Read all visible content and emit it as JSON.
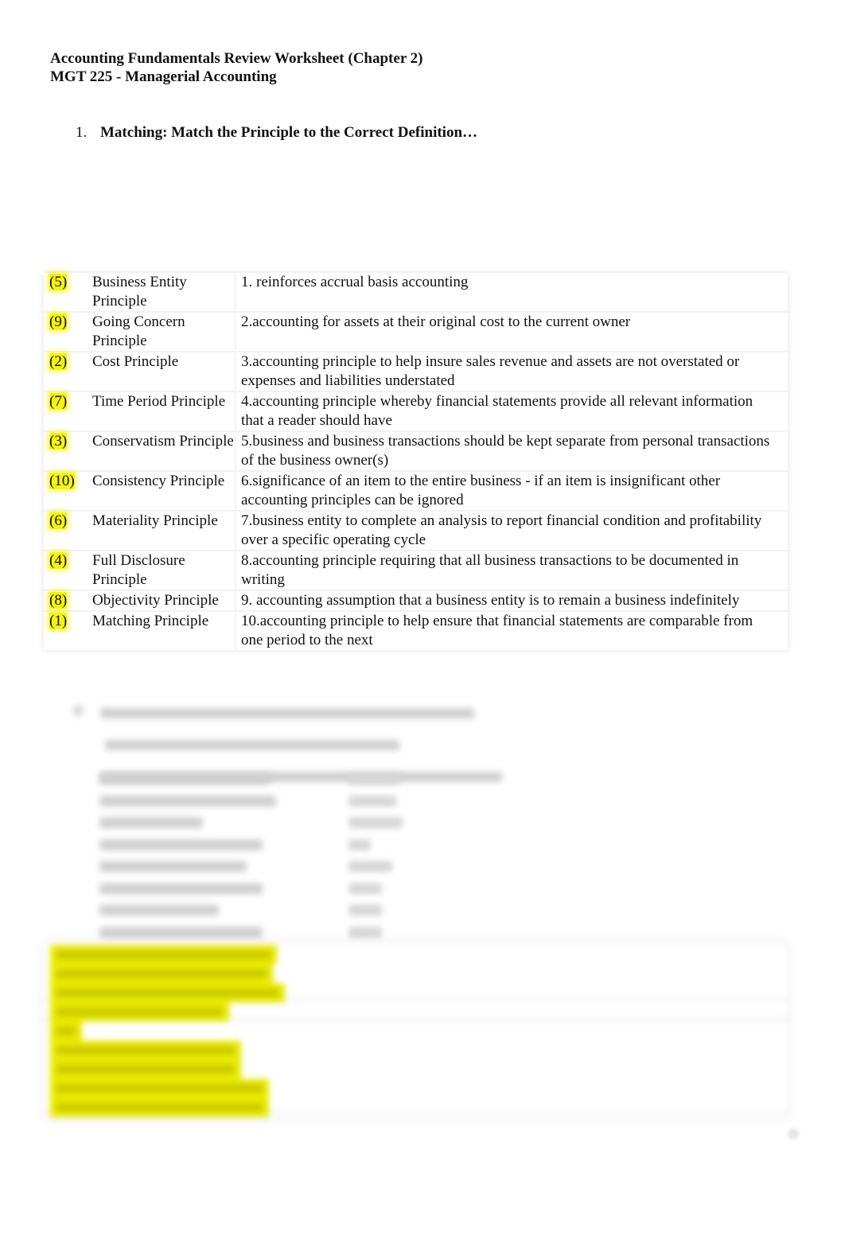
{
  "document": {
    "title": "Accounting Fundamentals Review Worksheet  (Chapter 2)",
    "course": "MGT 225 - Managerial Accounting"
  },
  "question1": {
    "number": "1.",
    "prompt": "Matching:  Match the Principle to the Correct Definition…",
    "highlight_color": "#f4f40f",
    "rows": [
      {
        "answer": "(5)",
        "principle": "Business Entity Principle",
        "definition": "1. reinforces accrual basis accounting"
      },
      {
        "answer": "(9)",
        "principle": "Going Concern Principle",
        "definition": "2.accounting for assets at their original cost to the current owner"
      },
      {
        "answer": "(2)",
        "principle": "Cost Principle",
        "definition": "3.accounting principle to help insure sales revenue and assets are not overstated or expenses and liabilities understated"
      },
      {
        "answer": "(7)",
        "principle": "Time Period Principle",
        "definition": "4.accounting principle whereby financial statements provide all relevant information that a reader should have"
      },
      {
        "answer": "(3)",
        "principle": " Conservatism Principle",
        "definition": "5.business and business transactions should be kept separate from personal transactions of the business owner(s)"
      },
      {
        "answer": "(10)",
        "principle": "Consistency Principle",
        "definition": "6.significance of an item to the entire business -  if an item is insignificant other accounting principles can be ignored"
      },
      {
        "answer": "(6)",
        "principle": "Materiality Principle",
        "definition": "7.business entity to complete an analysis to report financial condition and profitability over a specific operating cycle"
      },
      {
        "answer": "(4)",
        "principle": "Full Disclosure Principle",
        "definition": "8.accounting principle requiring that all business transactions to be documented in writing"
      },
      {
        "answer": "(8)",
        "principle": "Objectivity Principle",
        "definition": "9. accounting assumption that a business entity is to remain a business indefinitely"
      },
      {
        "answer": "(1)",
        "principle": "Matching Principle",
        "definition": "10.accounting principle to help ensure that financial statements are comparable from one period to the next"
      }
    ]
  },
  "question2": {
    "obscured": true,
    "data_rows": 8,
    "answer_lines": 9,
    "highlight_color": "#e9ea00"
  }
}
